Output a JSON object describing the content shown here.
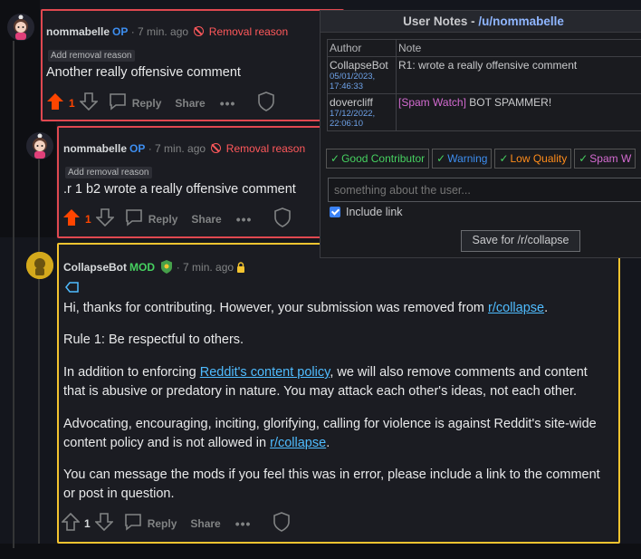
{
  "comments": [
    {
      "author": "nommabelle",
      "flair": "OP",
      "time": "· 7 min. ago",
      "removal_label": "Removal reason",
      "tag_button": "Add removal reason",
      "body": "Another really offensive comment",
      "score": "1",
      "reply_label": "Reply",
      "share_label": "Share",
      "more_label": "•••"
    },
    {
      "author": "nommabelle",
      "flair": "OP",
      "time": "· 7 min. ago",
      "removal_label": "Removal reason",
      "tag_button": "Add removal reason",
      "body": ".r 1 b2 wrote a really offensive comment",
      "score": "1",
      "reply_label": "Reply",
      "share_label": "Share",
      "more_label": "•••"
    },
    {
      "author": "CollapseBot",
      "flair": "MOD",
      "time": "· 7 min. ago",
      "body_p1_pre": "Hi, thanks for contributing. However, your submission was removed from ",
      "body_p1_link": "r/collapse",
      "body_p1_post": ".",
      "body_p2": "Rule 1: Be respectful to others.",
      "body_p3_pre": "In addition to enforcing ",
      "body_p3_link": "Reddit's content policy",
      "body_p3_post": ", we will also remove comments and content",
      "body_p3_line2": "that is abusive or predatory in nature. You may attack each other's ideas, not each other.",
      "body_p4_line1": "Advocating, encouraging, inciting, glorifying, calling for violence is against Reddit's site-wide",
      "body_p4_pre": "content policy and is not allowed in ",
      "body_p4_link": "r/collapse",
      "body_p4_post": ".",
      "body_p5_line1": "You can message the mods if you feel this was in error, please include a link to the comment",
      "body_p5_line2": "or post in question.",
      "score": "1",
      "reply_label": "Reply",
      "share_label": "Share",
      "more_label": "•••"
    }
  ],
  "user_notes": {
    "title_prefix": "User Notes - ",
    "username": "/u/nommabelle",
    "columns": [
      "Author",
      "Note"
    ],
    "rows": [
      {
        "author": "CollapseBot",
        "date": "05/01/2023,",
        "time": "17:46:33",
        "note_tag": "",
        "note": "R1: wrote a really offensive comment"
      },
      {
        "author": "dovercliff",
        "date": "17/12/2022,",
        "time": "22:06:10",
        "note_tag": "[Spam Watch]",
        "note": " BOT SPAMMER!"
      }
    ],
    "note_types": [
      {
        "label": "Good Contributor",
        "color": "#46d160"
      },
      {
        "label": "Warning",
        "color": "#3d8ef0"
      },
      {
        "label": "Low Quality",
        "color": "#ff8c1a"
      },
      {
        "label": "Spam W",
        "color": "#d46bd1"
      }
    ],
    "input_placeholder": "something about the user...",
    "include_link_label": "Include link",
    "include_link_checked": true,
    "save_label": "Save for /r/collapse"
  }
}
